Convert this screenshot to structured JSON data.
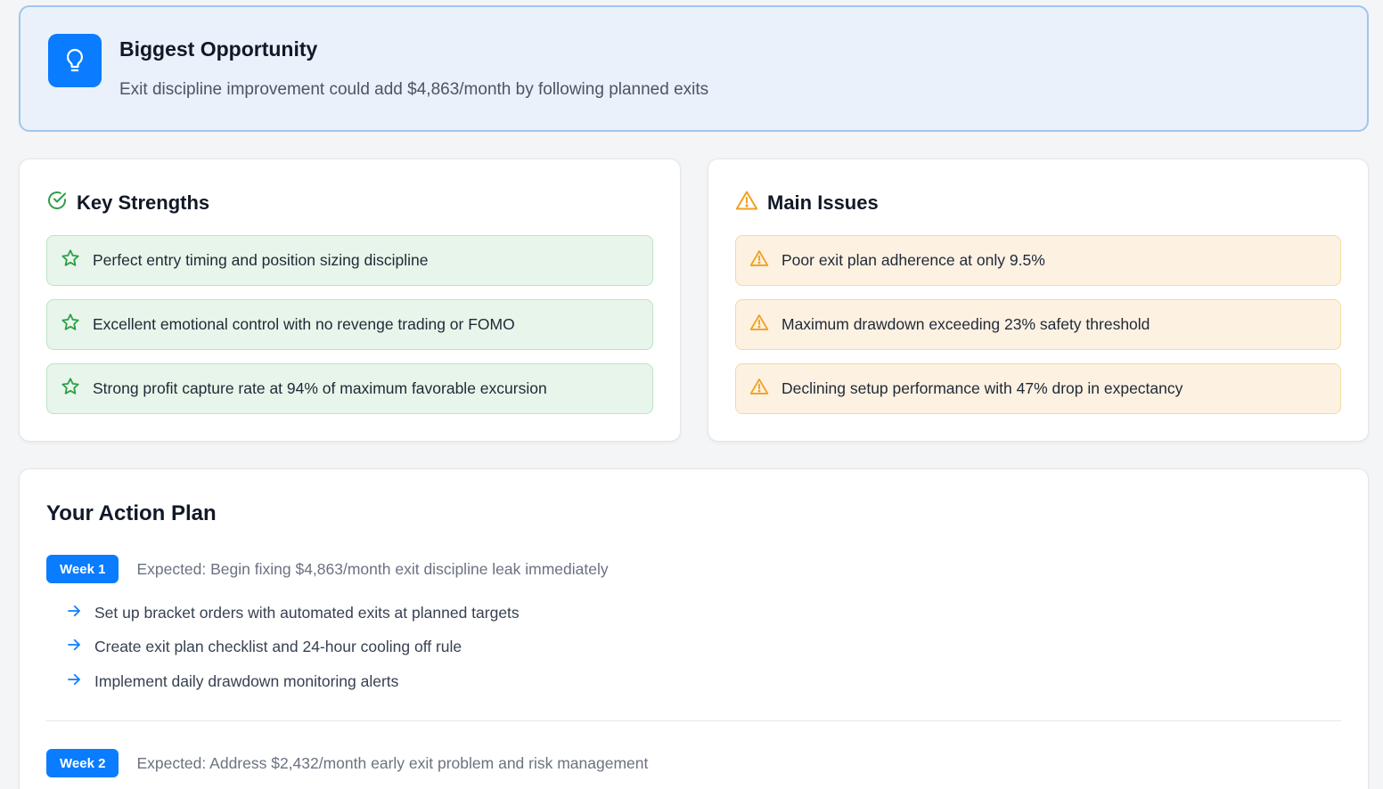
{
  "opportunity": {
    "title": "Biggest Opportunity",
    "description": "Exit discipline improvement could add $4,863/month by following planned exits",
    "icon": "lightbulb-icon"
  },
  "strengths": {
    "title": "Key Strengths",
    "icon": "check-circle-icon",
    "items": [
      {
        "text": "Perfect entry timing and position sizing discipline",
        "icon": "star-icon"
      },
      {
        "text": "Excellent emotional control with no revenge trading or FOMO",
        "icon": "star-icon"
      },
      {
        "text": "Strong profit capture rate at 94% of maximum favorable excursion",
        "icon": "star-icon"
      }
    ]
  },
  "issues": {
    "title": "Main Issues",
    "icon": "warning-icon",
    "items": [
      {
        "text": "Poor exit plan adherence at only 9.5%",
        "icon": "warning-icon"
      },
      {
        "text": "Maximum drawdown exceeding 23% safety threshold",
        "icon": "warning-icon"
      },
      {
        "text": "Declining setup performance with 47% drop in expectancy",
        "icon": "warning-icon"
      }
    ]
  },
  "action_plan": {
    "title": "Your Action Plan",
    "weeks": [
      {
        "label": "Week 1",
        "expected": "Expected: Begin fixing $4,863/month exit discipline leak immediately",
        "tasks": [
          "Set up bracket orders with automated exits at planned targets",
          "Create exit plan checklist and 24-hour cooling off rule",
          "Implement daily drawdown monitoring alerts"
        ]
      },
      {
        "label": "Week 2",
        "expected": "Expected: Address $2,432/month early exit problem and risk management"
      }
    ]
  },
  "colors": {
    "accent": "#0a7cff",
    "success": "#2e9e48",
    "warning": "#f0a020"
  }
}
